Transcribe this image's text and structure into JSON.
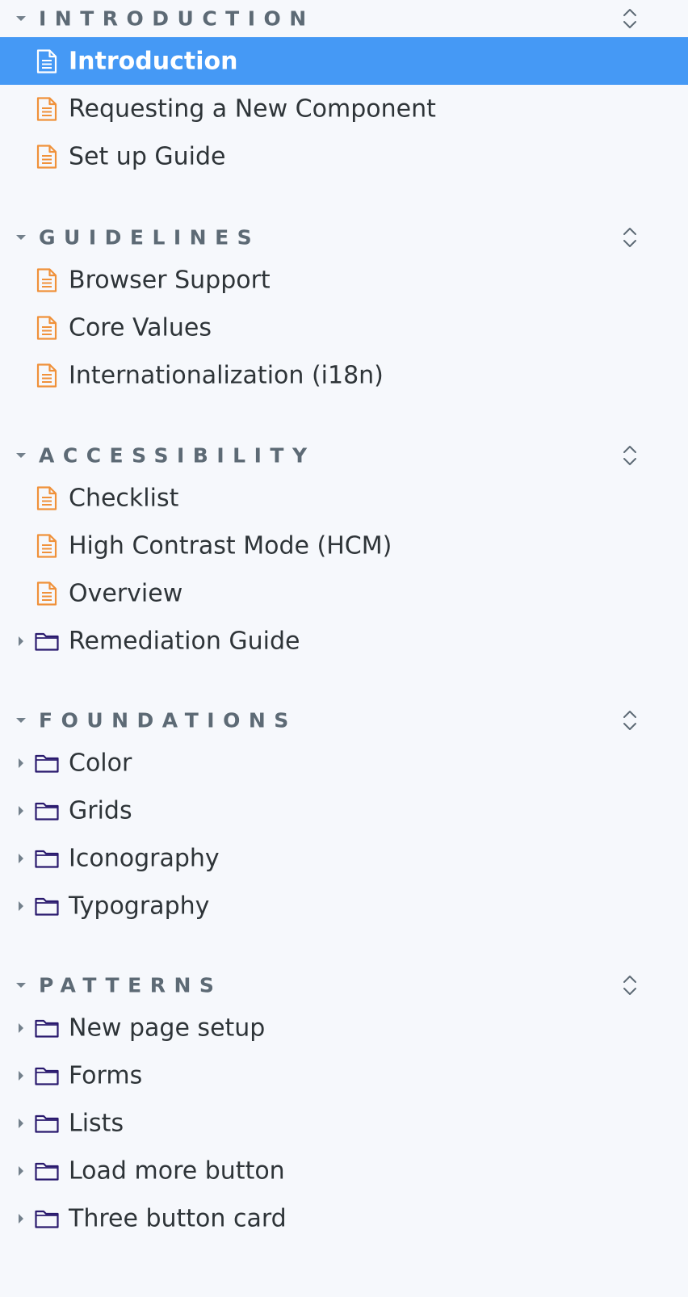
{
  "sections": [
    {
      "id": "introduction",
      "title": "INTRODUCTION",
      "items": [
        {
          "label": "Introduction",
          "type": "doc",
          "active": true
        },
        {
          "label": "Requesting a New Component",
          "type": "doc"
        },
        {
          "label": "Set up Guide",
          "type": "doc"
        }
      ]
    },
    {
      "id": "guidelines",
      "title": "GUIDELINES",
      "items": [
        {
          "label": "Browser Support",
          "type": "doc"
        },
        {
          "label": "Core Values",
          "type": "doc"
        },
        {
          "label": "Internationalization (i18n)",
          "type": "doc"
        }
      ]
    },
    {
      "id": "accessibility",
      "title": "ACCESSIBILITY",
      "items": [
        {
          "label": "Checklist",
          "type": "doc"
        },
        {
          "label": "High Contrast Mode (HCM)",
          "type": "doc"
        },
        {
          "label": "Overview",
          "type": "doc"
        },
        {
          "label": "Remediation Guide",
          "type": "folder"
        }
      ]
    },
    {
      "id": "foundations",
      "title": "FOUNDATIONS",
      "items": [
        {
          "label": "Color",
          "type": "folder"
        },
        {
          "label": "Grids",
          "type": "folder"
        },
        {
          "label": "Iconography",
          "type": "folder"
        },
        {
          "label": "Typography",
          "type": "folder"
        }
      ]
    },
    {
      "id": "patterns",
      "title": "PATTERNS",
      "items": [
        {
          "label": "New page setup",
          "type": "folder"
        },
        {
          "label": "Forms",
          "type": "folder"
        },
        {
          "label": "Lists",
          "type": "folder"
        },
        {
          "label": "Load more button",
          "type": "folder"
        },
        {
          "label": "Three button card",
          "type": "folder"
        }
      ]
    }
  ],
  "colors": {
    "background": "#f6f8fc",
    "active_row": "#4599f5",
    "doc_icon": "#f0913a",
    "folder_icon": "#2a1a6e",
    "section_title": "#5d6a75",
    "item_text": "#2e3438"
  },
  "icons": {
    "doc": "document-icon",
    "folder": "folder-icon",
    "section_caret": "caret-down-icon",
    "item_caret": "caret-right-icon",
    "expand": "expand-collapse-icon"
  }
}
